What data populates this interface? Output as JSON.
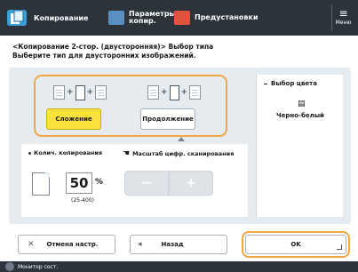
{
  "header": {
    "title": "Копирование",
    "tabs": [
      {
        "label": "Параметры копир."
      },
      {
        "label": "Предустановки"
      }
    ],
    "menu_label": "Меню"
  },
  "breadcrumb": {
    "line1": "<Копирование 2-стор. (двусторонняя)> Выбор типа",
    "line2": "Выберите тип для двусторонних изображений."
  },
  "options": [
    {
      "label": "Сложение",
      "selected": true
    },
    {
      "label": "Продолжение",
      "selected": false
    }
  ],
  "right_panel": {
    "title": "Выбор цвета",
    "value": "Черно-белый"
  },
  "counter": {
    "label": "Колич. копирования",
    "value": "50",
    "unit": "%",
    "range": "(25-400)"
  },
  "zoom": {
    "label": "Масштаб цифр. сканирования"
  },
  "buttons": {
    "cancel": "Отмена настр.",
    "back": "Назад",
    "ok": "OK"
  },
  "status": {
    "text": "Монитор сост."
  },
  "colors": {
    "accent": "#f0a642",
    "selected": "#f7e13a",
    "header": "#2c333b"
  }
}
